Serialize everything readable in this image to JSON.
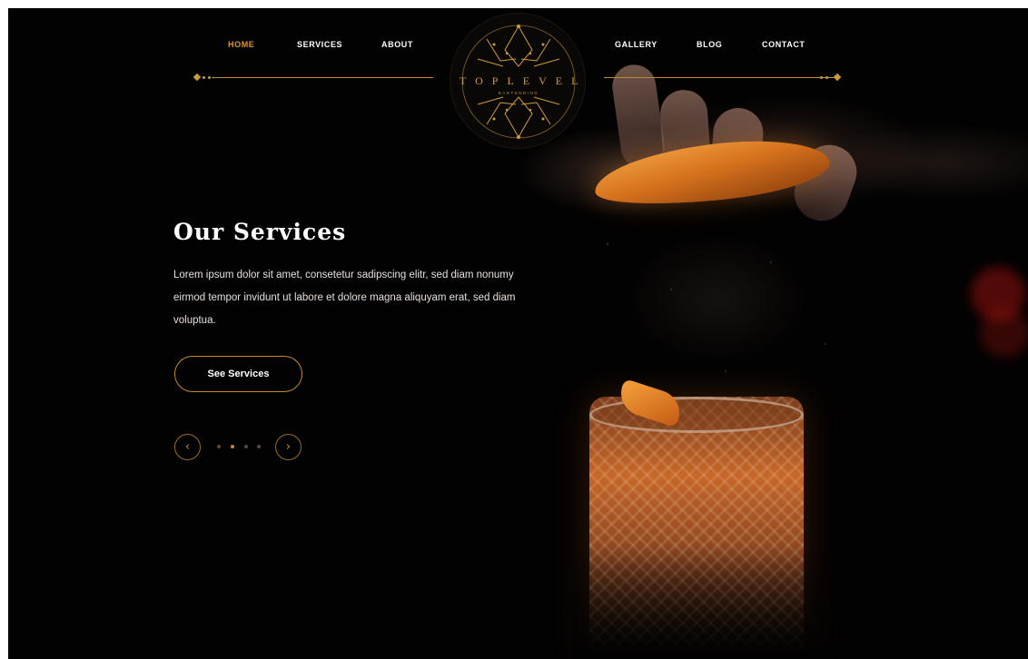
{
  "nav": {
    "left": [
      {
        "label": "HOME",
        "active": true
      },
      {
        "label": "SERVICES",
        "active": false
      },
      {
        "label": "ABOUT",
        "active": false
      }
    ],
    "right": [
      {
        "label": "GALLERY",
        "active": false
      },
      {
        "label": "BLOG",
        "active": false
      },
      {
        "label": "CONTACT",
        "active": false
      }
    ]
  },
  "logo": {
    "wordmark": "TOPLEVEL",
    "subtitle": "BARTENDING"
  },
  "hero": {
    "title": "Our Services",
    "text": "Lorem ipsum dolor sit amet, consetetur sadipscing elitr, sed diam nonumy eirmod tempor invidunt ut labore et dolore magna aliquyam erat, sed diam voluptua.",
    "cta_label": "See Services"
  },
  "carousel": {
    "prev_icon": "chevron-left-icon",
    "next_icon": "chevron-right-icon",
    "slide_count": 4,
    "active_slide": 2
  },
  "colors": {
    "accent": "#d9962d",
    "background": "#030202",
    "text": "#ffffff"
  }
}
